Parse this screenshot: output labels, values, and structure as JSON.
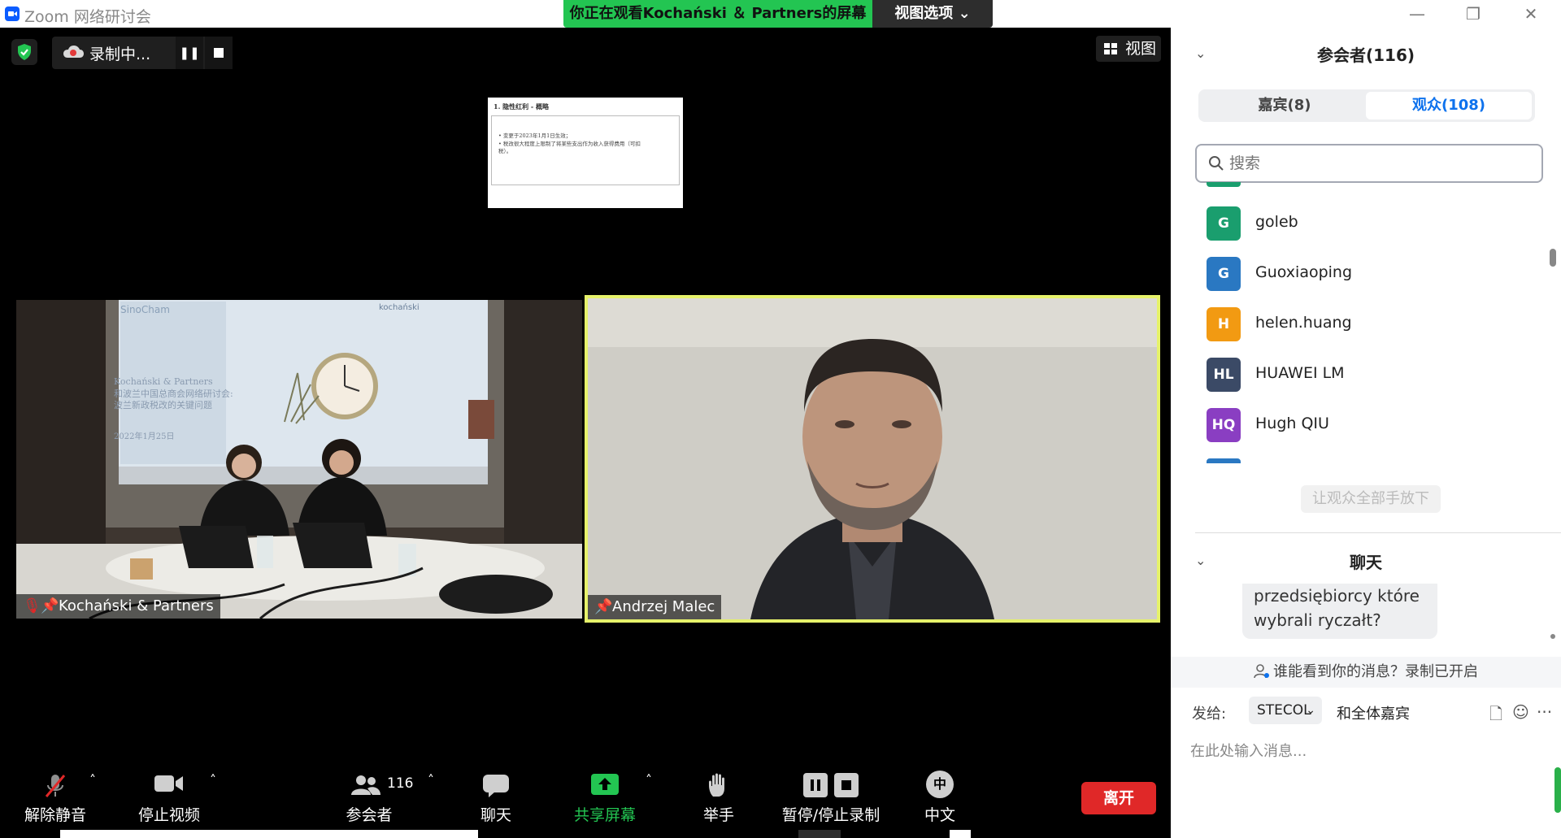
{
  "app": {
    "title": "Zoom 网络研讨会",
    "share_banner": "你正在观看Kochański ＆ Partners的屏幕",
    "view_options": "视图选项 ⌄",
    "window": {
      "minimize": "—",
      "restore": "❐",
      "close": "✕"
    }
  },
  "stage": {
    "recording_label": "录制中...",
    "pause_glyph": "❚❚",
    "view_button": "视图",
    "slide": {
      "title": "1. 隐性红利 - 概略",
      "bullet1": "• 变更于2023年1月1日生效；",
      "bullet2": "• 税改很大程度上限制了将某些支出作为收入获得费用（可扣",
      "bullet3": "   税）。"
    },
    "tiles": [
      {
        "name": "Kochański & Partners",
        "muted": true
      },
      {
        "name": "Andrzej Malec",
        "muted": false,
        "active_speaker": true
      }
    ]
  },
  "toolbar": {
    "unmute": "解除静音",
    "stop_video": "停止视频",
    "participants": "参会者",
    "participant_count": "116",
    "chat": "聊天",
    "share_screen": "共享屏幕",
    "raise_hand": "举手",
    "pause_stop_recording": "暂停/停止录制",
    "language": "中文",
    "language_badge": "中",
    "leave": "离开",
    "caret": "˄"
  },
  "panel": {
    "participants_header": "参会者(116)",
    "collapse_glyph": "⌄",
    "tabs": {
      "panelists": "嘉宾(8)",
      "attendees": "观众(108)"
    },
    "search_placeholder": "搜索",
    "attendees": [
      {
        "initials": "G",
        "name": "goleb",
        "color": "#1a9e6e"
      },
      {
        "initials": "G",
        "name": "Guoxiaoping",
        "color": "#2a78c2"
      },
      {
        "initials": "H",
        "name": "helen.huang",
        "color": "#f29a12"
      },
      {
        "initials": "HL",
        "name": "HUAWEI LM",
        "color": "#3b4a66"
      },
      {
        "initials": "HQ",
        "name": "Hugh QIU",
        "color": "#8a3ec2"
      }
    ],
    "lower_all_hands": "让观众全部手放下",
    "chat_header": "聊天",
    "chat_message_line1": "przedsiębiorcy które",
    "chat_message_line2": "wybrali ryczałt?",
    "visibility_notice": "谁能看到你的消息？录制已开启",
    "send_to_label": "发给:",
    "send_to_value": "STECOL",
    "send_to_suffix": "和全体嘉宾",
    "message_placeholder": "在此处输入消息...",
    "file_glyph": "🗋",
    "emoji_glyph": "☺",
    "more_glyph": "···"
  }
}
